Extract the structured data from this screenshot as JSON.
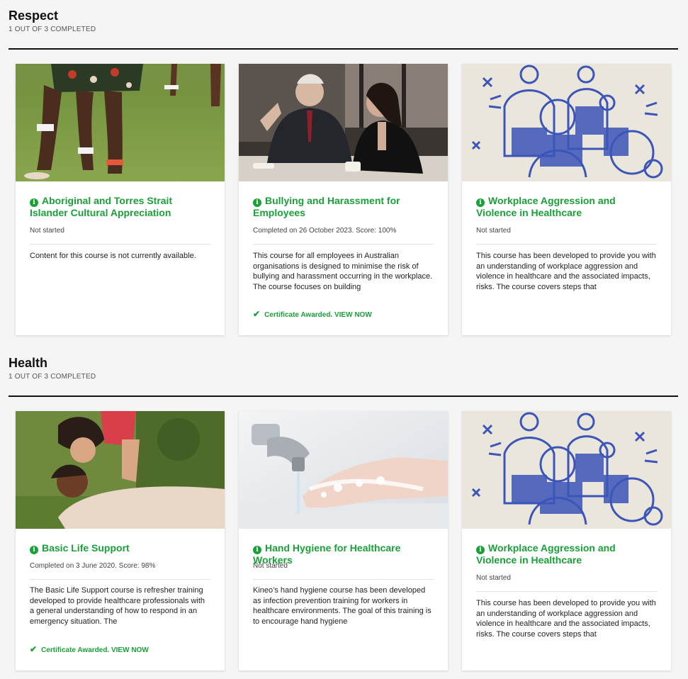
{
  "sections": [
    {
      "title": "Respect",
      "progress": "1 OUT OF 3 COMPLETED",
      "cards": [
        {
          "image": "aboriginal-culture-photo",
          "title": "Aboriginal and Torres Strait Islander Cultural Appreciation",
          "status": "Not started",
          "description": "Content for this course is not currently available.",
          "certificate": ""
        },
        {
          "image": "office-workers-photo",
          "title": "Bullying and Harassment for Employees",
          "status": "Completed on 26 October 2023. Score: 100%",
          "description": "This course for all employees in Australian organisations is designed to minimise the risk of bullying and harassment occurring in the workplace. The course focuses on building",
          "certificate": "Certificate Awarded. VIEW NOW"
        },
        {
          "image": "healthcare-illustration",
          "title": "Workplace Aggression and Violence in Healthcare",
          "status": "Not started",
          "description": "This course has been developed to provide you with an understanding of workplace aggression and violence in healthcare and the associated impacts, risks. The course covers steps that",
          "certificate": ""
        }
      ]
    },
    {
      "title": "Health",
      "progress": "1 OUT OF 3 COMPLETED",
      "cards": [
        {
          "image": "cpr-photo",
          "title": "Basic Life Support",
          "status": "Completed on 3 June 2020. Score: 98%",
          "description": "The Basic Life Support course is refresher training developed to provide healthcare professionals with a general understanding of how to respond in an emergency situation. The",
          "certificate": "Certificate Awarded. VIEW NOW"
        },
        {
          "image": "hand-washing-photo",
          "title": "Hand Hygiene for Healthcare Workers",
          "status": "Not started",
          "description": "Kineo’s hand hygiene course has been developed as infection prevention training for workers in healthcare environments. The goal of this training is to encourage hand hygiene",
          "certificate": ""
        },
        {
          "image": "healthcare-illustration",
          "title": "Workplace Aggression and Violence in Healthcare",
          "status": "Not started",
          "description": "This course has been developed to provide you with an understanding of workplace aggression and violence in healthcare and the associated impacts, risks. The course covers steps that",
          "certificate": ""
        }
      ]
    }
  ],
  "colors": {
    "accent": "#1aa038",
    "rule": "#111111",
    "background": "#f5f5f5"
  },
  "icons": {
    "title": "info-icon",
    "certificate": "check-icon"
  }
}
